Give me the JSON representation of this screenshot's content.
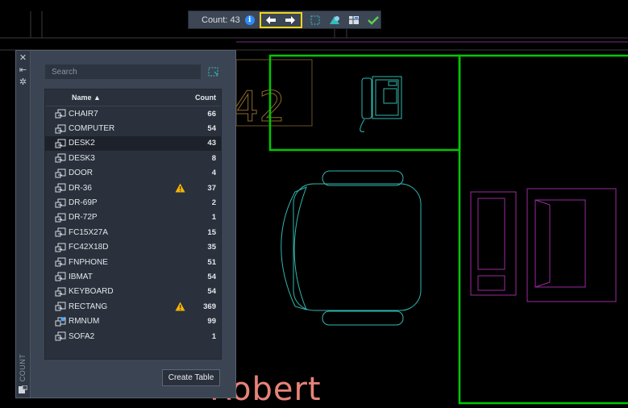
{
  "toolbar": {
    "count_label": "Count: 43",
    "info_icon": "info-icon",
    "prev_icon": "arrow-left-icon",
    "next_icon": "arrow-right-icon",
    "zoom_icon": "zoom-selection-icon",
    "replace_icon": "replace-block-icon",
    "table_icon": "insert-table-icon",
    "done_icon": "check-icon"
  },
  "palette": {
    "vertical_title": "COUNT",
    "close_icon": "close-icon",
    "autohide_icon": "autohide-icon",
    "settings_icon": "settings-icon",
    "corner_icon": "properties-icon",
    "search_placeholder": "Search",
    "list_header": {
      "name": "Name ▲",
      "count": "Count"
    },
    "items": [
      {
        "name": "CHAIR7",
        "count": "66"
      },
      {
        "name": "COMPUTER",
        "count": "54"
      },
      {
        "name": "DESK2",
        "count": "43",
        "selected": true
      },
      {
        "name": "DESK3",
        "count": "8"
      },
      {
        "name": "DOOR",
        "count": "4"
      },
      {
        "name": "DR-36",
        "count": "37",
        "warning": true
      },
      {
        "name": "DR-69P",
        "count": "2"
      },
      {
        "name": "DR-72P",
        "count": "1"
      },
      {
        "name": "FC15X27A",
        "count": "15"
      },
      {
        "name": "FC42X18D",
        "count": "35"
      },
      {
        "name": "FNPHONE",
        "count": "51"
      },
      {
        "name": "IBMAT",
        "count": "54"
      },
      {
        "name": "KEYBOARD",
        "count": "54"
      },
      {
        "name": "RECTANG",
        "count": "369",
        "warning": true
      },
      {
        "name": "RMNUM",
        "count": "99",
        "special": true
      },
      {
        "name": "SOFA2",
        "count": "1"
      }
    ],
    "create_table_label": "Create Table"
  },
  "drawing": {
    "room_number_text": "42",
    "name_text": "Robert"
  },
  "colors": {
    "highlight_green": "#00c800",
    "toolbar_bg": "#3c4654",
    "palette_bg": "#3b4453",
    "accent_yellow": "#f2d51c",
    "warning": "#f5b400"
  }
}
